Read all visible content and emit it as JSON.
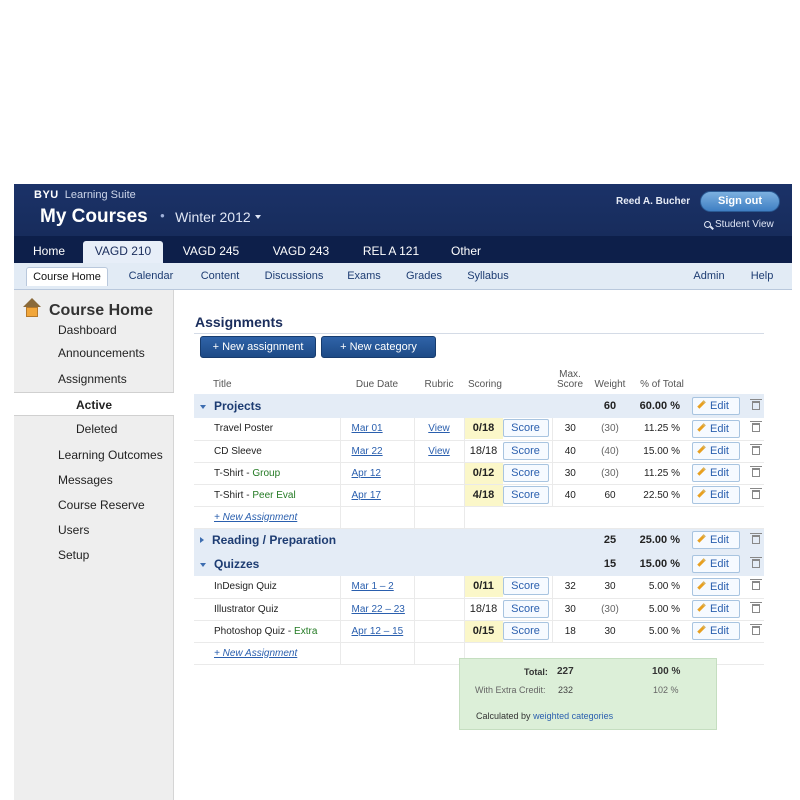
{
  "header": {
    "brand": "BYU",
    "brand_sub": "Learning Suite",
    "title": "My Courses",
    "term": "Winter 2012",
    "user": "Reed A. Bucher",
    "sign_out": "Sign out",
    "student_view": "Student View"
  },
  "course_tabs": [
    "Home",
    "VAGD 210",
    "VAGD 245",
    "VAGD 243",
    "REL A 121",
    "Other"
  ],
  "active_course_tab": "VAGD 210",
  "subnav": {
    "left": [
      "Course Home",
      "Calendar",
      "Content",
      "Discussions",
      "Exams",
      "Grades",
      "Syllabus"
    ],
    "right": [
      "Admin",
      "Help"
    ],
    "active": "Course Home"
  },
  "sidebar": {
    "heading": "Course Home",
    "items": [
      "Dashboard",
      "Announcements",
      "Assignments"
    ],
    "sub_items": [
      "Active",
      "Deleted"
    ],
    "items2": [
      "Learning Outcomes",
      "Messages",
      "Course Reserve",
      "Users",
      "Setup"
    ]
  },
  "main": {
    "title": "Assignments",
    "new_assignment_btn": "+ New assignment",
    "new_category_btn": "+ New category",
    "columns": {
      "title": "Title",
      "due": "Due Date",
      "rubric": "Rubric",
      "scoring": "Scoring",
      "max1": "Max.",
      "max2": "Score",
      "weight": "Weight",
      "pct": "% of Total"
    },
    "edit_label": "Edit",
    "score_label": "Score",
    "view_label": "View",
    "new_assignment_link": "+ New Assignment",
    "categories": [
      {
        "name": "Projects",
        "weight": "60",
        "pct": "60.00 %",
        "expanded": true,
        "rows": [
          {
            "title": "Travel Poster",
            "extra": "",
            "due": "Mar 01",
            "rubric": true,
            "score": "0/18",
            "highlight": true,
            "max": "30",
            "weight": "(30)",
            "pct": "11.25 %"
          },
          {
            "title": "CD Sleeve",
            "extra": "",
            "due": "Mar 22",
            "rubric": true,
            "score": "18/18",
            "highlight": false,
            "max": "40",
            "weight": "(40)",
            "pct": "15.00 %"
          },
          {
            "title": "T-Shirt - ",
            "extra": "Group",
            "due": "Apr 12",
            "rubric": false,
            "score": "0/12",
            "highlight": true,
            "max": "30",
            "weight": "(30)",
            "pct": "11.25 %"
          },
          {
            "title": "T-Shirt - ",
            "extra": "Peer Eval",
            "due": "Apr 17",
            "rubric": false,
            "score": "4/18",
            "highlight": true,
            "max": "40",
            "weight": "60",
            "pct": "22.50 %"
          }
        ]
      },
      {
        "name": "Reading / Preparation",
        "weight": "25",
        "pct": "25.00 %",
        "expanded": false,
        "rows": []
      },
      {
        "name": "Quizzes",
        "weight": "15",
        "pct": "15.00 %",
        "expanded": true,
        "rows": [
          {
            "title": "InDesign Quiz",
            "extra": "",
            "due": "Mar 1 – 2",
            "rubric": false,
            "score": "0/11",
            "highlight": true,
            "max": "32",
            "weight": "30",
            "pct": "5.00 %"
          },
          {
            "title": "Illustrator Quiz",
            "extra": "",
            "due": "Mar 22 – 23",
            "rubric": false,
            "score": "18/18",
            "highlight": false,
            "max": "30",
            "weight": "(30)",
            "pct": "5.00 %"
          },
          {
            "title": "Photoshop Quiz - ",
            "extra": "Extra",
            "due": "Apr 12 – 15",
            "rubric": false,
            "score": "0/15",
            "highlight": true,
            "max": "18",
            "weight": "30",
            "pct": "5.00 %"
          }
        ]
      }
    ],
    "totals": {
      "total_label": "Total:",
      "total": "227",
      "total_pct": "100 %",
      "extra_label": "With Extra Credit:",
      "extra": "232",
      "extra_pct": "102 %",
      "calc_prefix": "Calculated by",
      "calc_link": "weighted categories"
    }
  }
}
